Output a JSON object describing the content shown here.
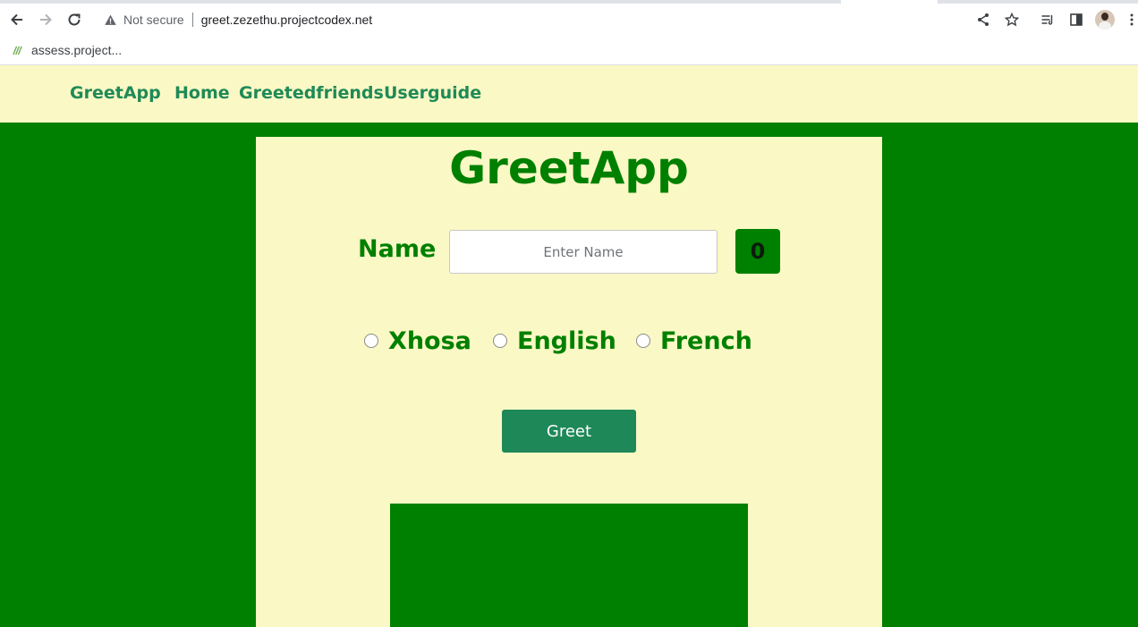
{
  "browser": {
    "security_label": "Not secure",
    "url": "greet.zezethu.projectcodex.net",
    "bookmark_label": "assess.project..."
  },
  "navbar": {
    "brand": "GreetApp",
    "links": [
      "Home",
      "Greetedfriends",
      "Userguide"
    ]
  },
  "main": {
    "title": "GreetApp",
    "name_label": "Name",
    "name_placeholder": "Enter Name",
    "name_value": "",
    "counter": "0",
    "languages": [
      "Xhosa",
      "English",
      "French"
    ],
    "greet_button": "Greet"
  },
  "colors": {
    "page_background": "#008000",
    "panel_background": "#faf8c5",
    "accent_text": "#008000",
    "nav_text": "#1f8a57",
    "button_background": "#1e8858"
  },
  "icons": {
    "back": "back-arrow-icon",
    "forward": "forward-arrow-icon",
    "reload": "reload-icon",
    "warning": "warning-triangle-icon",
    "share": "share-icon",
    "bookmark_star": "star-icon",
    "reading_list": "reading-list-icon",
    "side_panel": "side-panel-icon",
    "profile": "avatar",
    "menu": "kebab-menu-icon",
    "bookmark_favicon": "favicon-icon"
  }
}
